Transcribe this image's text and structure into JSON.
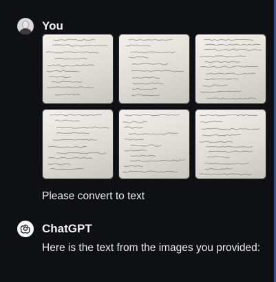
{
  "user_message": {
    "sender": "You",
    "images": [
      {
        "alt": "handwritten-notes-1"
      },
      {
        "alt": "handwritten-notes-2"
      },
      {
        "alt": "handwritten-notes-3"
      },
      {
        "alt": "handwritten-notes-4"
      },
      {
        "alt": "handwritten-notes-5"
      },
      {
        "alt": "handwritten-notes-6"
      }
    ],
    "text": "Please convert to text"
  },
  "assistant_message": {
    "sender": "ChatGPT",
    "text": "Here is the text from the images you provided:"
  },
  "colors": {
    "background": "#0f1014",
    "text": "#ececec",
    "accent_edge": "#2c53a8"
  }
}
